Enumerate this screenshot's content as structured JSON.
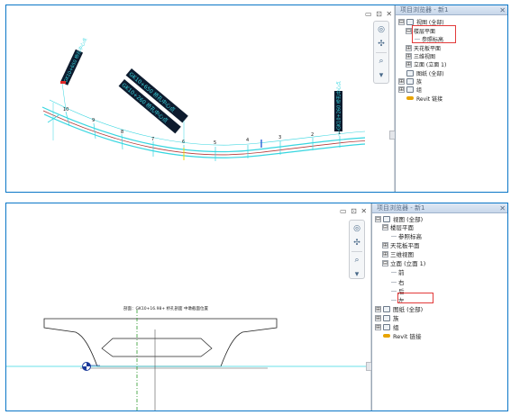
{
  "panel_top": {
    "canvas_labels": {
      "stations": [
        "10",
        "9",
        "8",
        "7",
        "6",
        "5",
        "4",
        "3",
        "2",
        "1"
      ],
      "rotated_1": "GK10+650 桥孔中心点",
      "rotated_2": "GK10+260 桥孔中心点"
    },
    "window_controls": "▭ ⊡ ✕",
    "browser": {
      "title": "项目浏览器 - 新1",
      "close": "✕",
      "items": [
        {
          "exp": "⊟",
          "label": "视图 (全部)"
        },
        {
          "exp": "⊟",
          "label": "楼层平面"
        },
        {
          "exp": "",
          "label": "参照标高"
        },
        {
          "exp": "⊞",
          "label": "天花板平面"
        },
        {
          "exp": "⊞",
          "label": "三维视图"
        },
        {
          "exp": "⊞",
          "label": "立面 (立面 1)"
        },
        {
          "exp": "",
          "label": "图纸 (全部)"
        },
        {
          "exp": "⊞",
          "label": "族"
        },
        {
          "exp": "⊞",
          "label": "组"
        },
        {
          "exp": "",
          "label": "Revit 链接"
        }
      ]
    }
  },
  "panel_bottom": {
    "window_controls": "▭ ⊡ ✕",
    "drawing_title": "剖面：GK10+16.98+  桥孔剖面    中墩截面位置",
    "browser": {
      "title": "项目浏览器 - 新1",
      "close": "✕",
      "items": [
        {
          "exp": "⊟",
          "label": "视图 (全部)"
        },
        {
          "exp": "⊟",
          "label": "楼层平面"
        },
        {
          "exp": "",
          "label": "参照标高"
        },
        {
          "exp": "⊞",
          "label": "天花板平面"
        },
        {
          "exp": "⊞",
          "label": "三维视图"
        },
        {
          "exp": "⊟",
          "label": "立面 (立面 1)"
        },
        {
          "exp": "",
          "label": "前"
        },
        {
          "exp": "",
          "label": "右"
        },
        {
          "exp": "",
          "label": "后"
        },
        {
          "exp": "",
          "label": "左"
        },
        {
          "exp": "⊞",
          "label": "图纸 (全部)"
        },
        {
          "exp": "⊞",
          "label": "族"
        },
        {
          "exp": "⊞",
          "label": "组"
        },
        {
          "exp": "",
          "label": "Revit 链接"
        }
      ]
    }
  },
  "colors": {
    "frame_border": "#0a76c7",
    "alignment_cyan": "#37d6e0",
    "alignment_red": "#b33a3a",
    "selection_red": "#e23a3a",
    "section_green": "#2e9a2e"
  }
}
